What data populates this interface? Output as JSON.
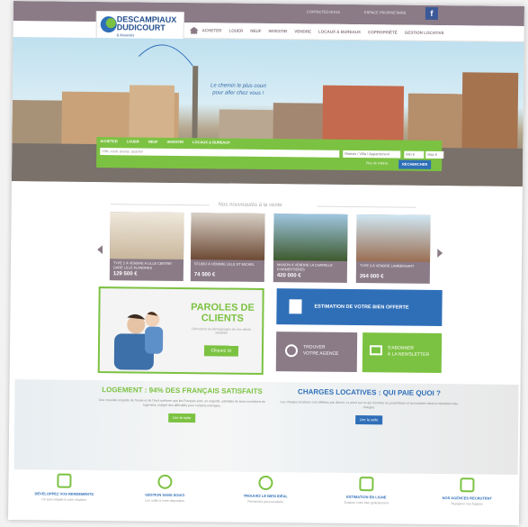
{
  "header": {
    "logo_line1": "DESCAMPIAUX",
    "logo_line2": "DUDICOURT",
    "logo_tagline": "& Associés",
    "util_links": [
      "CONTACTEZ-NOUS",
      "ESPACE PROPRIÉTAIRE"
    ],
    "facebook": "f",
    "nav": [
      "ACHETER",
      "LOUER",
      "NEUF",
      "INVESTIR",
      "VENDRE",
      "LOCAUX & BUREAUX",
      "COPROPRIÉTÉ",
      "GESTION LOCATIVE"
    ]
  },
  "hero": {
    "tagline_line1": "Le chemin le plus court",
    "tagline_line2": "pour aller chez vous !"
  },
  "search": {
    "tabs": [
      "ACHETER",
      "LOUER",
      "NEUF",
      "INVESTIR",
      "LOCAUX & BUREAUX"
    ],
    "placeholder": "Ville, code postal, quartier",
    "type_select": "Maison / Villa / Appartement",
    "min_select": "Min €",
    "max_select": "Max €",
    "more_link": "Plus de critères",
    "button": "RECHERCHER"
  },
  "section_title": "Nos nouveautés à la vente",
  "listings": [
    {
      "title": "TYPE 2 À VENDRE À LILLE CENTRE · GARE LILLE FLANDRES",
      "price": "129 500 €"
    },
    {
      "title": "STUDIO À VENDRE LILLE ST MICHEL",
      "price": "74 500 €"
    },
    {
      "title": "MAISON À VENDRE LA CHAPELLE D'ARMENTIÈRES",
      "price": "420 000 €"
    },
    {
      "title": "TYPE 3 À VENDRE LAMBERSART",
      "price": "264 000 €"
    }
  ],
  "testimonials": {
    "heading_line1": "PAROLES DE",
    "heading_line2": "CLIENTS",
    "subtitle": "Découvrez les témoignages de nos clients satisfaits",
    "button": "Cliquez ici"
  },
  "estimation": {
    "label": "ESTIMATION DE VOTRE BIEN OFFERTE"
  },
  "agence": {
    "line1": "TROUVER",
    "line2": "VOTRE AGENCE"
  },
  "newsletter": {
    "line1": "S'ABONNER",
    "line2": "À LA NEWSLETTER"
  },
  "articles": [
    {
      "heading": "LOGEMENT : 94% DES FRANÇAIS SATISFAITS",
      "body": "Une nouvelle enquête de l'Insee et de l'Anil confirme que les Français sont, en majorité, satisfaits de leurs conditions de logement, malgré des difficultés pour certains ménages.",
      "button": "Lire la suite"
    },
    {
      "heading": "CHARGES LOCATIVES : QUI PAIE QUOI ?",
      "body": "Les charges locatives sont définies par décret. Le point sur ce qui incombe au propriétaire et au locataire dans la répartition des charges.",
      "button": "Lire la suite"
    }
  ],
  "features": [
    {
      "title": "DÉVELOPPEZ VOS RENDEMENTS",
      "sub": "Un suivi adapté à votre situation"
    },
    {
      "title": "GESTION SANS SOUCI",
      "sub": "Les outils à votre disposition"
    },
    {
      "title": "TROUVEZ LE BIEN IDÉAL",
      "sub": "Recherche personnalisée"
    },
    {
      "title": "ESTIMATION EN LIGNE",
      "sub": "Évaluez votre bien gratuitement"
    },
    {
      "title": "NOS AGENCES RECRUTENT",
      "sub": "Rejoignez nos équipes"
    }
  ],
  "colors": {
    "brand_green": "#7cc242",
    "brand_blue": "#2f6fb8",
    "brand_mauve": "#8b7b87"
  }
}
